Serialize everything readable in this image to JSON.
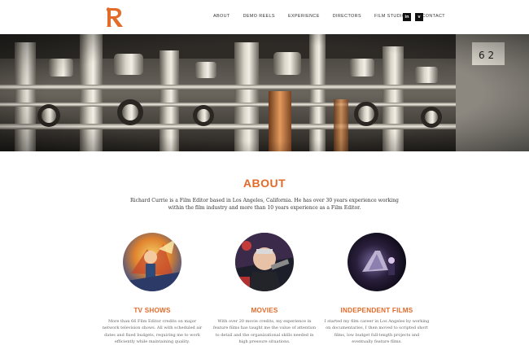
{
  "brand": {
    "logo_letter": "R",
    "accent": "#e26b2a"
  },
  "nav": {
    "items": [
      "ABOUT",
      "DEMO REELS",
      "EXPERIENCE",
      "DIRECTORS",
      "FILM STUDIOS",
      "CONTACT"
    ],
    "social": [
      "in",
      "v"
    ]
  },
  "hero": {
    "icon": "film-editing-machine-image"
  },
  "about": {
    "title": "ABOUT",
    "text": "Richard Currie is a Film Editor based in Los Angeles, California. He has over 30 years experience working within the film industry and more than 10 years experience as a Film Editor."
  },
  "columns": [
    {
      "title": "TV SHOWS",
      "text": "More than 66 Film Editor credits on major network television shows. All with scheduled air dates and fixed budgets, requiring me to work efficiently while maintaining quality.",
      "icon": "tv-shows-poster-image"
    },
    {
      "title": "MOVIES",
      "text": "With over 20 movie credits, my experience in feature films has taught me the value of attention to detail and the organizational skills needed in high pressure situations.",
      "icon": "movies-poster-image"
    },
    {
      "title": "INDEPENDENT FILMS",
      "text": "I started my film career in Los Angeles by working on documentaries, I then moved to scripted short films, low budget full-length projects and eventually feature films.",
      "icon": "independent-film-still-image"
    }
  ]
}
